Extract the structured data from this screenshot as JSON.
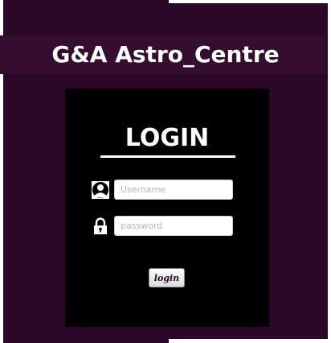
{
  "header": {
    "title": "G&A Astro_Centre"
  },
  "login": {
    "heading": "LOGIN",
    "username": {
      "icon": "user-icon",
      "placeholder": "Username",
      "value": ""
    },
    "password": {
      "icon": "lock-icon",
      "placeholder": "password",
      "value": ""
    },
    "button_label": "login"
  },
  "colors": {
    "background": "#2b0827",
    "header_band": "#350d30",
    "panel": "#000000",
    "text": "#ffffff"
  }
}
